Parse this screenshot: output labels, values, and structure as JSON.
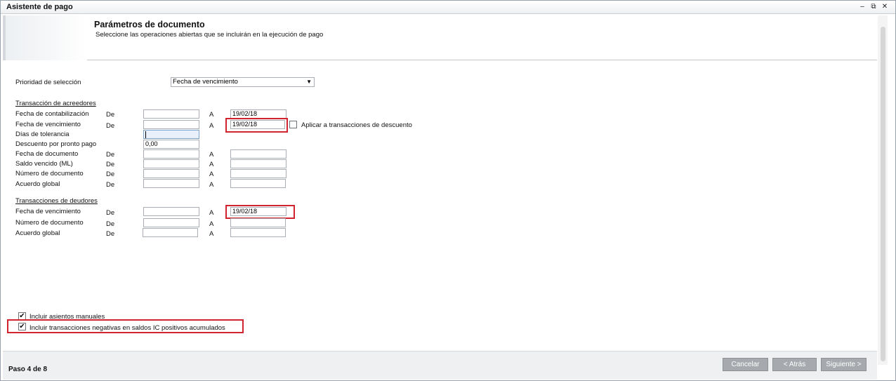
{
  "window": {
    "title": "Asistente de pago",
    "minimize_glyph": "–",
    "restore_glyph": "⧉",
    "close_glyph": "✕"
  },
  "header": {
    "title": "Parámetros de documento",
    "subtitle": "Seleccione las operaciones abiertas que se incluirán en la ejecución de pago"
  },
  "priority": {
    "label": "Prioridad de selección",
    "selected": "Fecha de vencimiento"
  },
  "creditors": {
    "title": "Transacción de acreedores",
    "de_label": "De",
    "a_label": "A",
    "rows": [
      {
        "label": "Fecha de contabilización",
        "from": "",
        "to": "19/02/18"
      },
      {
        "label": "Fecha de vencimiento",
        "from": "",
        "to": "19/02/18"
      },
      {
        "label": "Días de tolerancia",
        "value": ""
      },
      {
        "label": "Descuento por pronto pago",
        "value": "0,00"
      },
      {
        "label": "Fecha de documento",
        "from": "",
        "to": ""
      },
      {
        "label": "Saldo vencido (ML)",
        "from": "",
        "to": ""
      },
      {
        "label": "Número de documento",
        "from": "",
        "to": ""
      },
      {
        "label": "Acuerdo global",
        "from": "",
        "to": ""
      }
    ],
    "apply_discount": {
      "label": "Aplicar a transacciones de descuento",
      "checked": false
    }
  },
  "debtors": {
    "title": "Transacciones de deudores",
    "rows": [
      {
        "label": "Fecha de vencimiento",
        "from": "",
        "to": "19/02/18"
      },
      {
        "label": "Número de documento",
        "from": "",
        "to": ""
      },
      {
        "label": "Acuerdo global",
        "from": "",
        "to": ""
      }
    ]
  },
  "options": {
    "manual_entries": {
      "label": "Incluir asientos manuales",
      "checked": true
    },
    "negative_ic": {
      "label": "Incluir transacciones negativas en saldos IC positivos acumulados",
      "checked": true
    },
    "check_glyph": "✔"
  },
  "footer": {
    "step": "Paso 4 de 8",
    "cancel": "Cancelar",
    "back": "< Atrás",
    "next": "Siguiente >"
  },
  "colors": {
    "highlight": "#d1242f",
    "button": "#a6a9ad"
  }
}
